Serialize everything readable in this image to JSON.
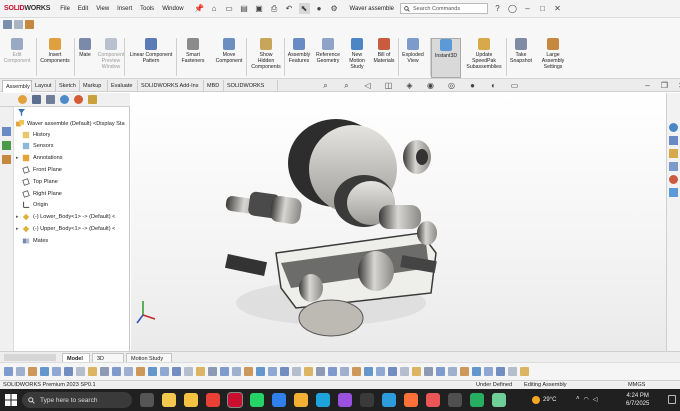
{
  "title_bar": {
    "logo_prefix": "SOLID",
    "logo_suffix": "WORKS",
    "menus": [
      "File",
      "Edit",
      "View",
      "Insert",
      "Tools",
      "Window"
    ],
    "document_name": "Waver assemble",
    "search_placeholder": "Search Commands"
  },
  "command_manager": {
    "commands": [
      {
        "label": "Edit\nComponent",
        "state": "disabled",
        "color": "#9aa9c4"
      },
      {
        "label": "Insert\nComponents",
        "state": "normal",
        "color": "#e0a040"
      },
      {
        "label": "Mate",
        "state": "normal",
        "color": "#7a8aa8"
      },
      {
        "label": "Component\nPreview\nWindow",
        "state": "disabled",
        "color": "#b9c1cf"
      },
      {
        "label": "Linear Component\nPattern",
        "state": "normal",
        "color": "#5b7bb7"
      },
      {
        "label": "Smart\nFasteners",
        "state": "normal",
        "color": "#8b8b8b"
      },
      {
        "label": "Move\nComponent",
        "state": "normal",
        "color": "#6d8fbf"
      },
      {
        "label": "Show\nHidden\nComponents",
        "state": "normal",
        "color": "#c7a55a"
      },
      {
        "label": "Assembly\nFeatures",
        "state": "normal",
        "color": "#6a8ac6"
      },
      {
        "label": "Reference\nGeometry",
        "state": "normal",
        "color": "#8fa2c7"
      },
      {
        "label": "New\nMotion\nStudy",
        "state": "normal",
        "color": "#4c86c4"
      },
      {
        "label": "Bill of\nMaterials",
        "state": "normal",
        "color": "#c95b3f"
      },
      {
        "label": "Exploded\nView",
        "state": "normal",
        "color": "#7c9acb"
      },
      {
        "label": "Instant3D",
        "state": "active",
        "color": "#5b9ad6"
      },
      {
        "label": "Update\nSpeedPak\nSubassemblies",
        "state": "normal",
        "color": "#d7a94a"
      },
      {
        "label": "Take\nSnapshot",
        "state": "normal",
        "color": "#7d8ba5"
      },
      {
        "label": "Large\nAssembly\nSettings",
        "state": "normal",
        "color": "#c6883e"
      }
    ],
    "tabs": [
      "Assembly",
      "Layout",
      "Sketch",
      "Markup",
      "Evaluate",
      "SOLIDWORKS Add-Ins",
      "MBD",
      "SOLIDWORKS CAM"
    ],
    "active_tab": "Assembly"
  },
  "feature_tree": {
    "root": "Waver assemble (Default) <Display Sta",
    "items": [
      {
        "label": "History",
        "icon": "history-icon",
        "expandable": false
      },
      {
        "label": "Sensors",
        "icon": "sensors-icon",
        "expandable": false
      },
      {
        "label": "Annotations",
        "icon": "annotations-icon",
        "expandable": true
      },
      {
        "label": "Front Plane",
        "icon": "plane-icon",
        "expandable": false
      },
      {
        "label": "Top Plane",
        "icon": "plane-icon",
        "expandable": false
      },
      {
        "label": "Right Plane",
        "icon": "plane-icon",
        "expandable": false
      },
      {
        "label": "Origin",
        "icon": "origin-icon",
        "expandable": false
      },
      {
        "label": "(-) Lower_Body<1> -> (Default) <",
        "icon": "part-icon",
        "expandable": true
      },
      {
        "label": "(-) Upper_Body<1> -> (Default) <",
        "icon": "part-icon",
        "expandable": true
      },
      {
        "label": "Mates",
        "icon": "mates-icon",
        "expandable": false
      }
    ]
  },
  "bottom_tabs": [
    "Model",
    "3D Views",
    "Motion Study 1"
  ],
  "active_bottom_tab": "Model",
  "status_bar": {
    "product": "SOLIDWORKS Premium 2023 SP0.1",
    "state": "Under Defined",
    "mode": "Editing Assembly",
    "units": "MMGS"
  },
  "taskbar": {
    "search_placeholder": "Type here to search",
    "temperature": "29°C",
    "time": "4:24 PM",
    "date": "6/7/2025"
  },
  "colors": {
    "solidworks_red": "#c8102e",
    "taskbar_bg": "#202020",
    "active_command_bg": "#d9d9d9"
  }
}
